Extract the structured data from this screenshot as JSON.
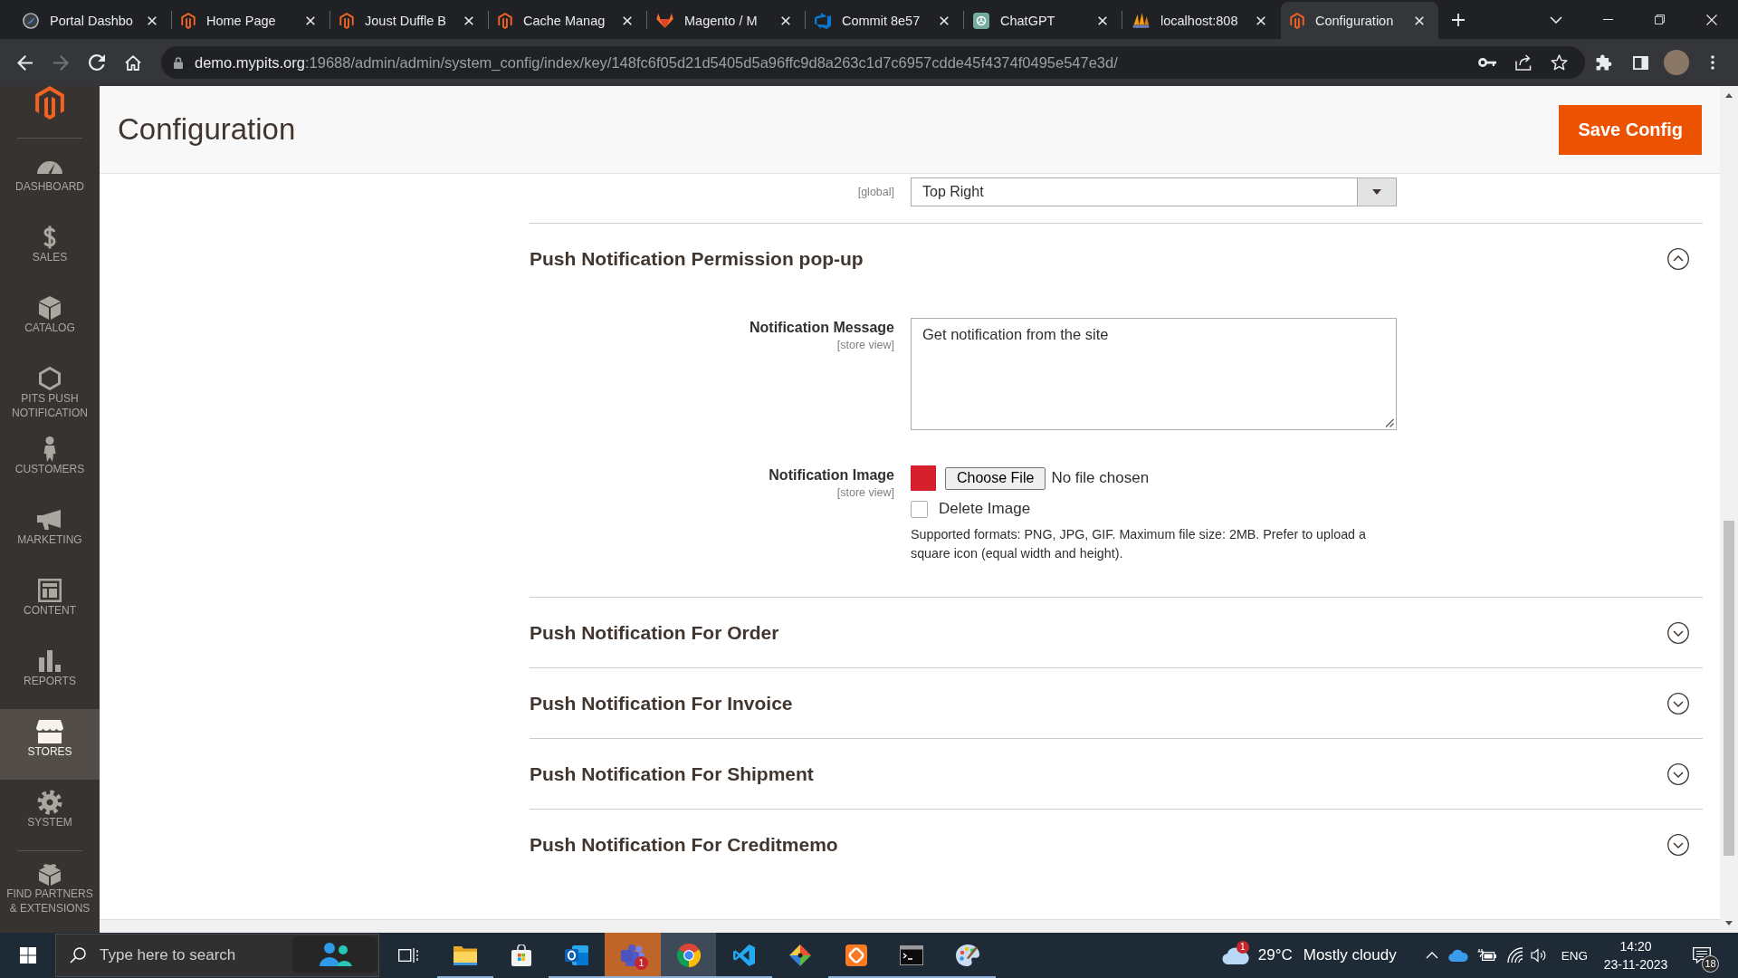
{
  "browser": {
    "tabs": [
      {
        "title": "Portal Dashbo",
        "selected": false
      },
      {
        "title": "Home Page",
        "selected": false
      },
      {
        "title": "Joust Duffle B",
        "selected": false
      },
      {
        "title": "Cache Manag",
        "selected": false
      },
      {
        "title": "Magento / M",
        "selected": false
      },
      {
        "title": "Commit 8e57",
        "selected": false
      },
      {
        "title": "ChatGPT",
        "selected": false
      },
      {
        "title": "localhost:808",
        "selected": false
      },
      {
        "title": "Configuration",
        "selected": true
      }
    ],
    "forward_disabled": true,
    "address": {
      "host": "demo.mypits.org",
      "path": ":19688/admin/admin/system_config/index/key/148fc6f05d21d5405d5a96ffc9d8a263c1d7c6957cdde45f4374f0495e547e3d/"
    }
  },
  "sidebar": {
    "items": [
      {
        "label": "DASHBOARD",
        "selected": false
      },
      {
        "label": "SALES",
        "selected": false
      },
      {
        "label": "CATALOG",
        "selected": false
      },
      {
        "label": "PITS PUSH NOTIFICATION",
        "selected": false
      },
      {
        "label": "CUSTOMERS",
        "selected": false
      },
      {
        "label": "MARKETING",
        "selected": false
      },
      {
        "label": "CONTENT",
        "selected": false
      },
      {
        "label": "REPORTS",
        "selected": false
      },
      {
        "label": "STORES",
        "selected": true
      },
      {
        "label": "SYSTEM",
        "selected": false
      },
      {
        "label": "FIND PARTNERS & EXTENSIONS",
        "selected": false
      }
    ]
  },
  "page": {
    "title": "Configuration",
    "save_button": "Save Config"
  },
  "partial_field": {
    "scope": "[global]",
    "value": "Top Right"
  },
  "sections": [
    {
      "title": "Push Notification Permission pop-up",
      "expanded": true,
      "fields": [
        {
          "kind": "textarea",
          "label": "Notification Message",
          "scope": "[store view]",
          "value": "Get notification from the site"
        },
        {
          "kind": "image",
          "label": "Notification Image",
          "scope": "[store view]",
          "button": "Choose File",
          "file_status": "No file chosen",
          "checkbox_label": "Delete Image",
          "checked": false,
          "note": "Supported formats: PNG, JPG, GIF. Maximum file size: 2MB. Prefer to upload a square icon (equal width and height)."
        }
      ]
    },
    {
      "title": "Push Notification For Order",
      "expanded": false
    },
    {
      "title": "Push Notification For Invoice",
      "expanded": false
    },
    {
      "title": "Push Notification For Shipment",
      "expanded": false
    },
    {
      "title": "Push Notification For Creditmemo",
      "expanded": false
    }
  ],
  "taskbar": {
    "search_placeholder": "Type here to search",
    "apps": [
      {
        "running": true,
        "selected": false,
        "attention": false
      },
      {
        "running": false,
        "selected": false,
        "attention": false
      },
      {
        "running": true,
        "selected": false,
        "attention": false
      },
      {
        "running": true,
        "selected": false,
        "attention": true,
        "badge": "1"
      },
      {
        "running": true,
        "selected": true,
        "attention": false
      },
      {
        "running": true,
        "selected": false,
        "attention": false
      },
      {
        "running": false,
        "selected": false,
        "attention": false
      },
      {
        "running": true,
        "selected": false,
        "attention": false
      },
      {
        "running": true,
        "selected": false,
        "attention": false
      },
      {
        "running": true,
        "selected": false,
        "attention": false
      }
    ],
    "weather": {
      "badge": "1",
      "temperature": "29°C",
      "condition": "Mostly cloudy"
    },
    "language": "ENG",
    "time": "14:20",
    "date": "23-11-2023",
    "notification_count": "18"
  }
}
